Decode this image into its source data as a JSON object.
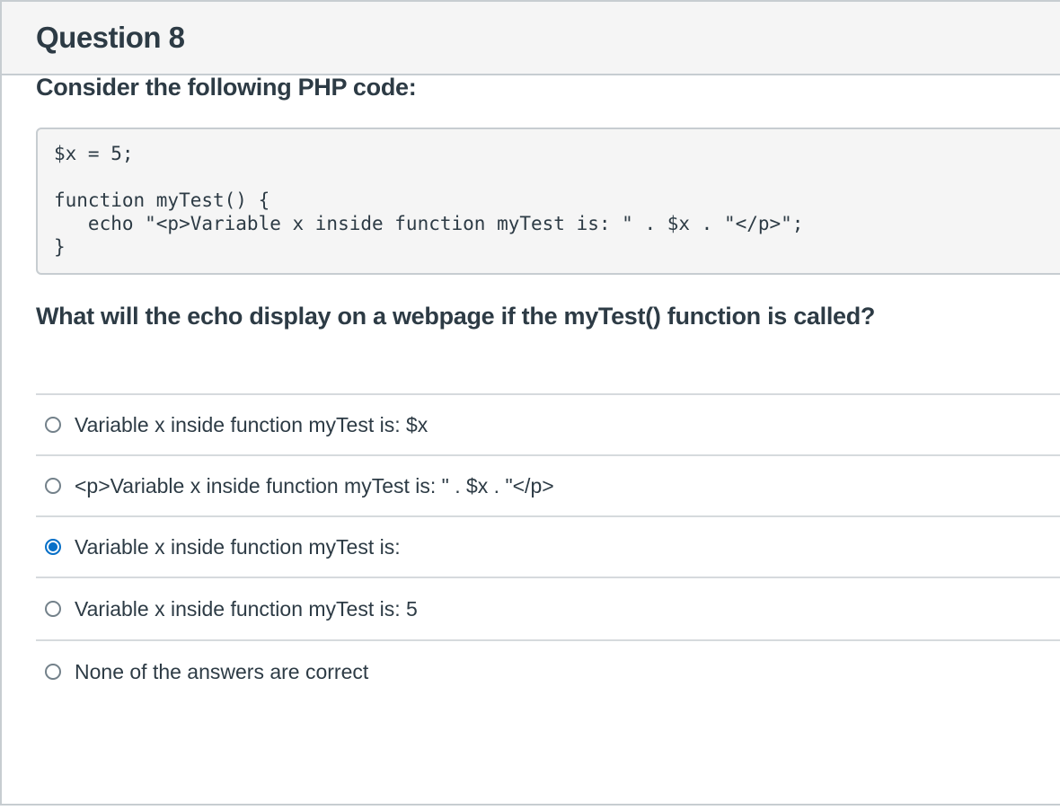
{
  "question": {
    "title": "Question 8",
    "prompt": "Consider the following PHP code:",
    "code": {
      "line1": "$x = 5;",
      "line2": "function myTest() {",
      "line3": "   echo \"<p>Variable x inside function myTest is: \" . $x . \"</p>\";",
      "line4": "}"
    },
    "question_text": "What will the echo display on a webpage if the myTest() function is called?"
  },
  "answers": [
    {
      "label": "Variable x inside function myTest is: $x",
      "selected": false
    },
    {
      "label": "<p>Variable x inside function myTest is: \" . $x . \"</p>",
      "selected": false
    },
    {
      "label": "Variable x inside function myTest is:",
      "selected": true
    },
    {
      "label": "Variable x inside function myTest is: 5",
      "selected": false
    },
    {
      "label": "None of the answers are correct",
      "selected": false
    }
  ],
  "colors": {
    "accent": "#0770c8",
    "text": "#2d3b45",
    "border": "#c7cdd1",
    "header_bg": "#f5f5f5"
  }
}
